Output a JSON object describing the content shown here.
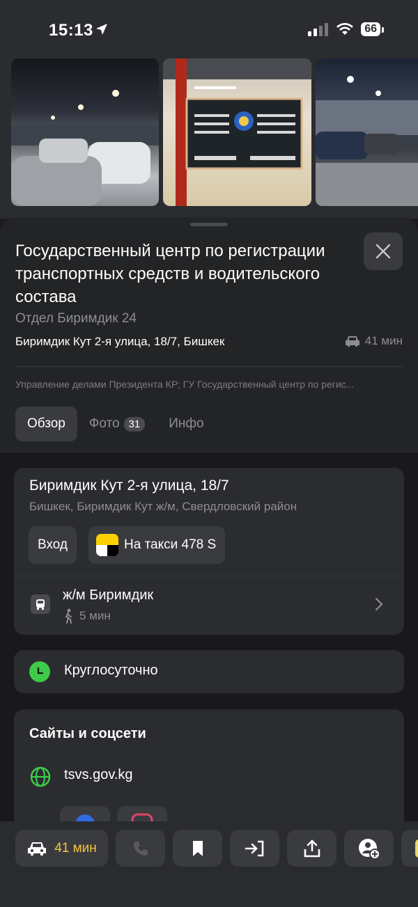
{
  "status": {
    "time": "15:13",
    "battery": "66"
  },
  "place": {
    "title": "Государственный центр по регистрации транспортных средств и водительского состава",
    "subtitle": "Отдел Биримдик 24",
    "address": "Биримдик Кут 2-я улица, 18/7, Бишкек",
    "eta": "41 мин",
    "org": "Управление делами Президента КР; ГУ Государственный центр по регис..."
  },
  "tabs": [
    {
      "label": "Обзор",
      "active": true
    },
    {
      "label": "Фото",
      "badge": "31"
    },
    {
      "label": "Инфо"
    }
  ],
  "address_card": {
    "street": "Биримдик Кут 2-я улица, 18/7",
    "district": "Бишкек, Биримдик Кут ж/м, Свердловский район",
    "entrance_label": "Вход",
    "taxi_label": "На такси 478 S",
    "transit_name": "ж/м Биримдик",
    "walk_time": "5 мин"
  },
  "hours": {
    "text": "Круглосуточно"
  },
  "sites": {
    "title": "Сайты и соцсети",
    "link": "tsvs.gov.kg"
  },
  "bottom_bar": {
    "route_label": "41 мин"
  },
  "colors": {
    "accent": "#f5c542",
    "open_green": "#3ecb4a",
    "link_green": "#3ecb4a"
  }
}
